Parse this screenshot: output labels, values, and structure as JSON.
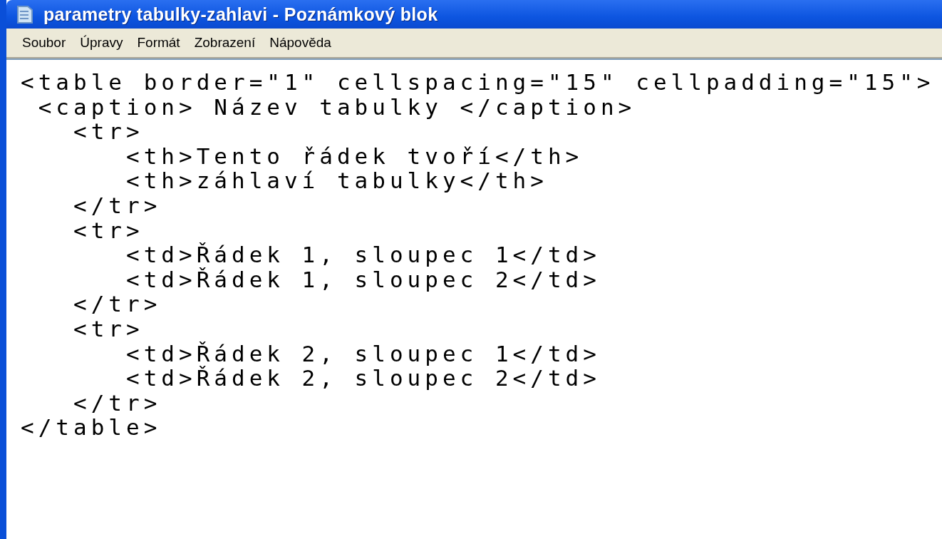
{
  "window": {
    "title": "parametry tabulky-zahlavi - Poznámkový blok"
  },
  "menu": [
    "Soubor",
    "Úpravy",
    "Formát",
    "Zobrazení",
    "Nápověda"
  ],
  "editor": {
    "lines": [
      "<table border=\"1\" cellspacing=\"15\" cellpadding=\"15\">",
      " <caption> Název tabulky </caption>",
      "   <tr>",
      "      <th>Tento řádek tvoří</th>",
      "      <th>záhlaví tabulky</th>",
      "   </tr>",
      "   <tr>",
      "      <td>Řádek 1, sloupec 1</td>",
      "      <td>Řádek 1, sloupec 2</td>",
      "   </tr>",
      "   <tr>",
      "      <td>Řádek 2, sloupec 1</td>",
      "      <td>Řádek 2, sloupec 2</td>",
      "   </tr>",
      "</table>"
    ]
  }
}
